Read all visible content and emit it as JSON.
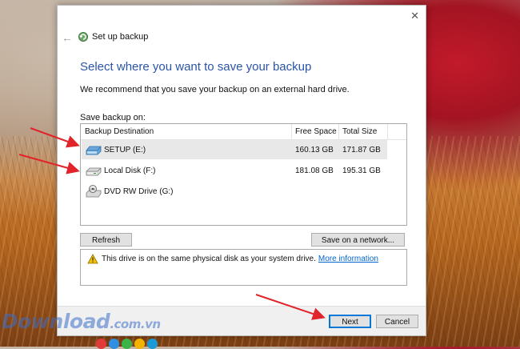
{
  "wizard": {
    "title": "Set up backup",
    "heading": "Select where you want to save your backup",
    "recommendation": "We recommend that you save your backup on an external hard drive.",
    "save_label": "Save backup on:",
    "columns": [
      "Backup Destination",
      "Free Space",
      "Total Size"
    ],
    "drives": [
      {
        "name": "SETUP (E:)",
        "free": "160.13 GB",
        "total": "171.87 GB",
        "icon": "usb-drive-icon",
        "selected": true
      },
      {
        "name": "Local Disk (F:)",
        "free": "181.08 GB",
        "total": "195.31 GB",
        "icon": "hard-disk-icon",
        "selected": false
      },
      {
        "name": "DVD RW Drive (G:)",
        "free": "",
        "total": "",
        "icon": "dvd-drive-icon",
        "selected": false
      }
    ],
    "refresh_label": "Refresh",
    "network_label": "Save on a network...",
    "info_text": "This drive is on the same physical disk as your system drive.",
    "info_link": "More information",
    "next_label": "Next",
    "cancel_label": "Cancel",
    "close_glyph": "✕",
    "back_glyph": "←"
  },
  "watermark": {
    "main": "Download",
    "suffix": ".com.vn"
  },
  "colors": {
    "heading": "#2a54a6",
    "link": "#0066cc",
    "arrow": "#e0242a",
    "accent": "#0078d7"
  }
}
